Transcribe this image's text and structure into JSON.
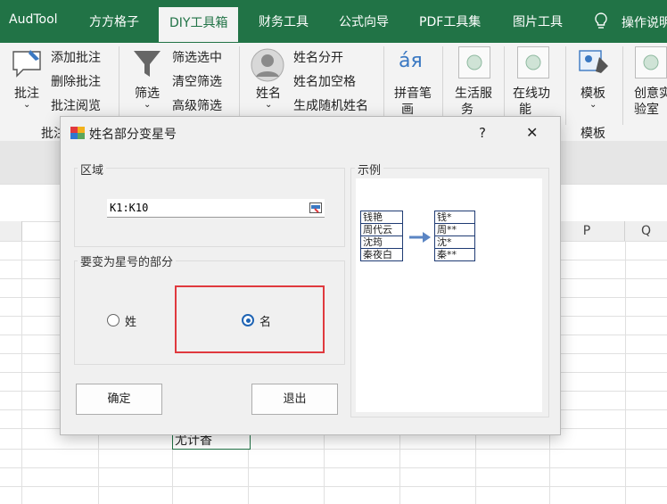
{
  "ribbon_tabs": [
    "AudTool",
    "方方格子",
    "DIY工具箱",
    "财务工具",
    "公式向导",
    "PDF工具集",
    "图片工具"
  ],
  "help_label": "操作说明",
  "ribbon": {
    "annot_btn": "批注",
    "annot_items": [
      "添加批注",
      "删除批注",
      "批注阅览"
    ],
    "annot_group": "批注",
    "filter_btn": "筛选",
    "filter_items": [
      "筛选选中",
      "清空筛选",
      "高级筛选"
    ],
    "name_btn": "姓名",
    "name_items": [
      "姓名分开",
      "姓名加空格",
      "生成随机姓名"
    ],
    "pinyin_glyph": "áя",
    "pinyin_btn_1": "拼音笔",
    "pinyin_btn_2": "画",
    "life_btn_1": "生活服",
    "life_btn_2": "务",
    "online_btn_1": "在线功",
    "online_btn_2": "能",
    "template_btn": "模板",
    "template_group": "模板",
    "lab_btn_1": "创意实",
    "lab_btn_2": "验室"
  },
  "grid": {
    "col_P": "P",
    "col_Q": "Q",
    "cell_value": "尤计香"
  },
  "dialog": {
    "title": "姓名部分变星号",
    "help": "?",
    "close": "✕",
    "range_group": "区域",
    "range_value": "K1:K10",
    "part_group": "要变为星号的部分",
    "option_surname": "姓",
    "option_given": "名",
    "selected": "名",
    "example_group": "示例",
    "example_before": [
      "钱艳",
      "周代云",
      "沈筠",
      "秦夜白"
    ],
    "example_after": [
      "钱*",
      "周**",
      "沈*",
      "秦**"
    ],
    "ok": "确定",
    "exit": "退出"
  },
  "colors": {
    "excel_green": "#217346",
    "highlight_red": "#e0393e",
    "radio_blue": "#1f64b4"
  }
}
